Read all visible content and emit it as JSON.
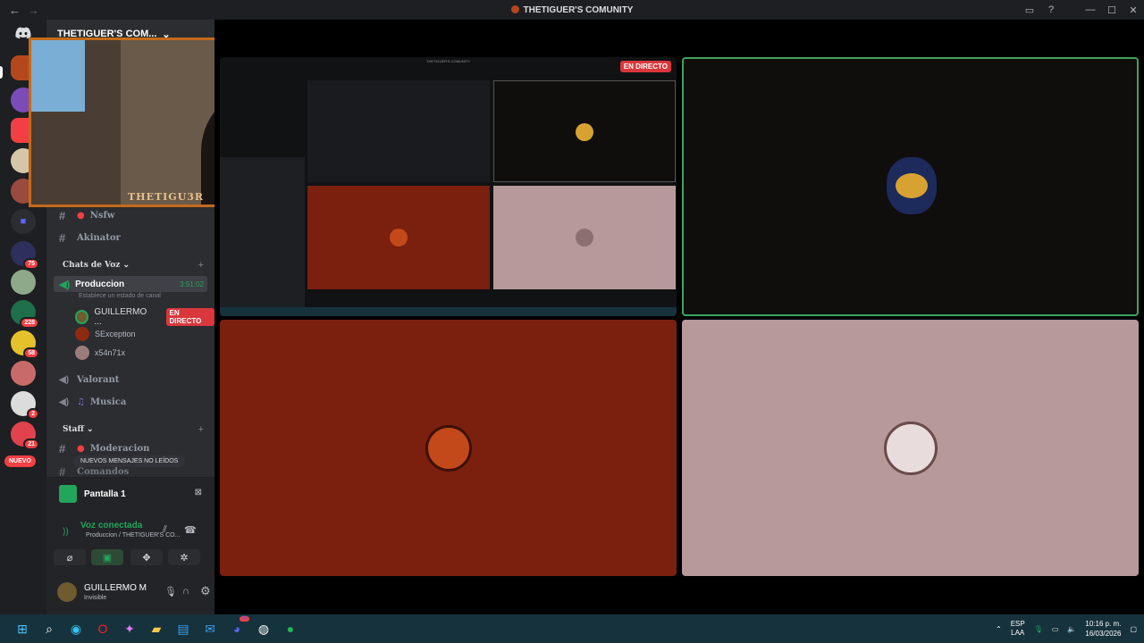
{
  "window": {
    "title": "THETIGUER'S COMUNITY",
    "back_icon": "←",
    "forward_icon": "→"
  },
  "server": {
    "name": "THETIGUER'S COM...",
    "webcam_overlay_label": "THETIGU3R"
  },
  "rail": {
    "badges": [
      "75",
      "228",
      "58",
      "2",
      "21"
    ],
    "new_label": "NUEVO"
  },
  "channels": {
    "text": [
      {
        "name": "Nsfw"
      },
      {
        "name": "Akinator"
      }
    ],
    "voice_category": "Chats de Voz",
    "active_voice": {
      "name": "Produccion",
      "timer": "3:51:02",
      "status_hint": "Establece un estado de canal"
    },
    "voice_users": [
      {
        "name": "GUILLERMO ...",
        "live": "EN DIRECTO"
      },
      {
        "name": "SException"
      },
      {
        "name": "x54n71x"
      }
    ],
    "other_voice": [
      {
        "name": "Valorant"
      },
      {
        "name": "Musica"
      }
    ],
    "staff_category": "Staff",
    "staff_channels": [
      {
        "name": "Moderacion"
      },
      {
        "name": "Comandos"
      }
    ],
    "new_messages_pill": "NUEVOS MENSAJES NO LEÍDOS"
  },
  "stream_panel": {
    "title": "Pantalla 1",
    "voice_status": "Voz conectada",
    "voice_location": "Produccion / THETIGUER'S CO..."
  },
  "user": {
    "name": "GUILLERMO M",
    "status": "Invisible"
  },
  "stage": {
    "live_tag": "EN DIRECTO",
    "inner_title": "THETIGUER'S COMUNITY"
  },
  "taskbar": {
    "lang_top": "ESP",
    "lang_bottom": "LAA",
    "time": "10:16 p. m.",
    "date": "16/03/2026",
    "discord_badge": "99"
  },
  "colors": {
    "live": "#da373c",
    "speaking_border": "#3ba55c",
    "voice_green": "#23a55a",
    "tile_red": "#7b1f0e",
    "tile_pink": "#b89999"
  }
}
